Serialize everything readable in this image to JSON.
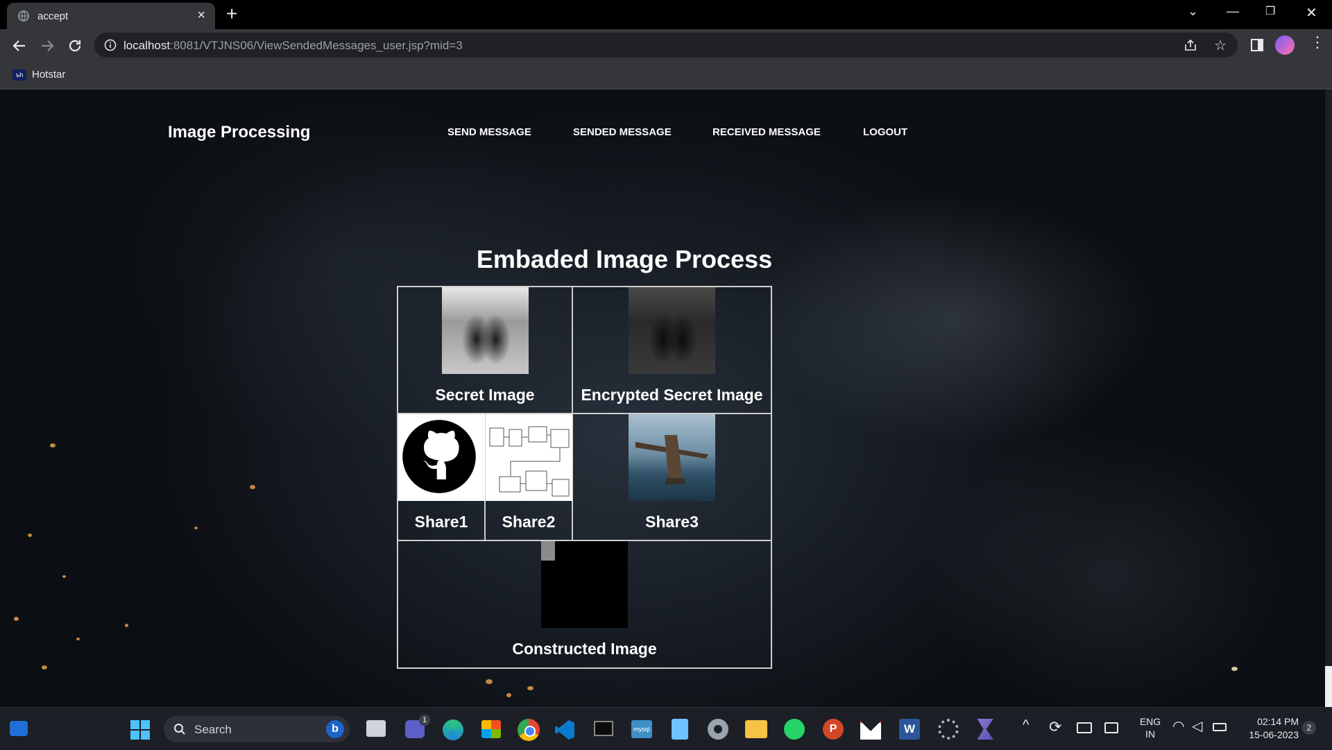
{
  "browser": {
    "tab_title": "accept",
    "url_host": "localhost",
    "url_rest": ":8081/VTJNS06/ViewSendedMessages_user.jsp?mid=3",
    "bookmark": "Hotstar",
    "bookmark_icon_text": "ъh"
  },
  "site": {
    "brand": "Image  Processing",
    "nav": [
      "SEND MESSAGE",
      "SENDED MESSAGE",
      "RECEIVED MESSAGE",
      "LOGOUT"
    ]
  },
  "main": {
    "heading": "Embaded Image Process",
    "cells": {
      "secret": "Secret Image",
      "encrypted": "Encrypted Secret Image",
      "share1": "Share1",
      "share2": "Share2",
      "share3": "Share3",
      "constructed": "Constructed Image"
    }
  },
  "taskbar": {
    "search_placeholder": "Search",
    "lang_top": "ENG",
    "lang_bottom": "IN",
    "time": "02:14 PM",
    "date": "15-06-2023",
    "notification_count": "2",
    "teams_badge": "1",
    "app_icons": [
      "start-icon",
      "search",
      "file-explorer-dark",
      "teams-icon",
      "edge-icon",
      "store-icon",
      "chrome-icon",
      "vscode-icon",
      "terminal-icon",
      "mysql-icon",
      "notepad-icon",
      "settings-icon",
      "folder-icon",
      "whatsapp-icon",
      "powerpoint-icon",
      "gmail-icon",
      "word-icon",
      "gear-app-icon",
      "netbeans-icon"
    ]
  },
  "colors": {
    "tabbar": "#000000",
    "toolbar": "#35363a",
    "taskbar": "#1c1f26",
    "page_text": "#ffffff"
  }
}
